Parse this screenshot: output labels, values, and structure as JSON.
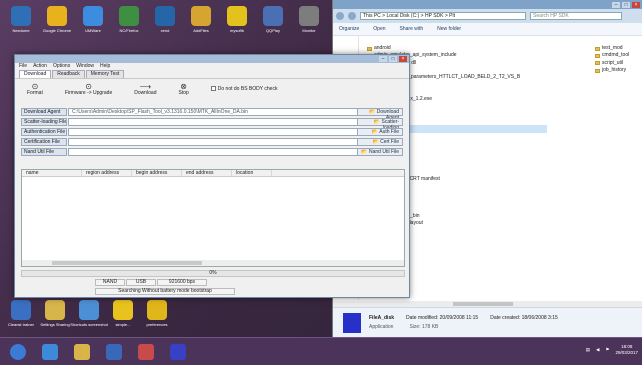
{
  "desktop": {
    "icons_top": [
      {
        "label": "Nexdome",
        "icon": "nexdome-icon",
        "color": "#2f6fb5"
      },
      {
        "label": "Google Chrome",
        "icon": "chrome-icon",
        "color": "#e8b21f"
      },
      {
        "label": "UMWare",
        "icon": "umware-icon",
        "color": "#3c8de0"
      },
      {
        "label": "NC/Firefox",
        "icon": "firefox-icon",
        "color": "#3f8f43"
      },
      {
        "label": "xend",
        "icon": "app-icon",
        "color": "#2466a8"
      },
      {
        "label": "AddFiles",
        "icon": "folder-icon",
        "color": "#d6a431"
      },
      {
        "label": "mysoftb",
        "icon": "smiley-icon",
        "color": "#e3c21d"
      },
      {
        "label": "QQPlay",
        "icon": "app-icon",
        "color": "#4a6fb3"
      },
      {
        "label": "Monitor",
        "icon": "monitor-icon",
        "color": "#7d7d7d"
      }
    ],
    "icons_bottom": [
      {
        "label": "Cleanst trainer",
        "icon": "app-icon",
        "color": "#3a6fc2"
      },
      {
        "label": "Settings Sharing",
        "icon": "app-icon",
        "color": "#d6b54a"
      },
      {
        "label": "Shortcuts screenshot",
        "icon": "screenshot-icon",
        "color": "#4b90d6"
      },
      {
        "label": "simple...",
        "icon": "smiley-icon",
        "color": "#e8c31e"
      },
      {
        "label": "preferences",
        "icon": "smiley-icon",
        "color": "#e0b71a"
      }
    ]
  },
  "explorer": {
    "address": "This PC > Local Disk (C:) > HP SDK > Plt",
    "search_placeholder": "Search HP SDK",
    "toolbar": [
      "Organize",
      "Open",
      "Share with",
      "New folder"
    ],
    "files": [
      "android",
      "admin_emulator_api_system_include",
      "audiotransmitter dll",
      "c90_RUNIT",
      "DPTLCSHTMC_parameters_HTTLCT_LOAD_BELD_2_T2_VS_B",
      "driver dll",
      "events",
      "CommonDriver_x_1.2.exe",
      "Checkboxes",
      "DLL",
      "pkcs1.dll",
      "FileA_disk",
      "FileB_disk",
      "fsalmodule dll",
      "gpu_driver dll",
      "gps_dll",
      "install_util",
      "HTTP_Driv dll",
      "Microsoft VC80 CRT manifest",
      "msvcr80 dll",
      "msvcp80 dll",
      "msvcp90 dll",
      "msvcr90 dll",
      "NTFS_adhesion_bin",
      "PMR_DevAPK_layout",
      "readme"
    ],
    "selected_index": 11,
    "right_files": [
      "test_mod",
      "cmdmd_tool",
      "script_util",
      "job_history"
    ],
    "details": {
      "name": "FileA_disk",
      "type": "Application",
      "date_modified": "Date modified: 20/09/2008 11:15",
      "size": "Size: 178 KB",
      "date_created": "Date created: 18/06/2008 3:15"
    }
  },
  "dialog": {
    "menu": [
      "File",
      "Action",
      "Options",
      "Window",
      "Help"
    ],
    "tabs": [
      "Download",
      "Readback",
      "Memory Test"
    ],
    "toolbar": [
      {
        "label": "Format",
        "glyph": "⊙"
      },
      {
        "label": "Firmware -> Upgrade",
        "glyph": "⊙"
      },
      {
        "label": "Download",
        "glyph": "⟶"
      },
      {
        "label": "Stop",
        "glyph": "⊗"
      }
    ],
    "checkbox_label": "Do not do BS BODY check",
    "fields": [
      {
        "label": "Download Agent",
        "value": "C:\\Users\\Admin\\Desktop\\SP_Flash_Tool_v3.1316.0.150\\MTK_AllInOne_DA.bin",
        "button": "Download Agent"
      },
      {
        "label": "Scatter-loading File",
        "value": "",
        "button": "Scatter-loading"
      },
      {
        "label": "Authentication File",
        "value": "",
        "button": "Auth File"
      },
      {
        "label": "Certification File",
        "value": "",
        "button": "Cert File"
      },
      {
        "label": "Nand Util File",
        "value": "",
        "button": "Nand Util File"
      }
    ],
    "grid_headers": [
      "name",
      "region address",
      "begin address",
      "end address",
      "location"
    ],
    "status_progress": "0%",
    "status_cells": [
      "NAND",
      "USB",
      "921600 bps"
    ],
    "status_bottom": "Searching Without battery mode bootstrap"
  },
  "taskbar": {
    "apps": [
      {
        "icon": "start-orb-icon",
        "color": "#3b7bd6"
      },
      {
        "icon": "internet-explorer-icon",
        "color": "#3c8ad8"
      },
      {
        "icon": "file-explorer-icon",
        "color": "#d9b44a"
      },
      {
        "icon": "media-player-icon",
        "color": "#3a68b8"
      },
      {
        "icon": "paint-icon",
        "color": "#c94a4a"
      },
      {
        "icon": "flash-tool-icon",
        "color": "#3841c4"
      }
    ],
    "time": "18:08",
    "date": "29/03/2017"
  }
}
